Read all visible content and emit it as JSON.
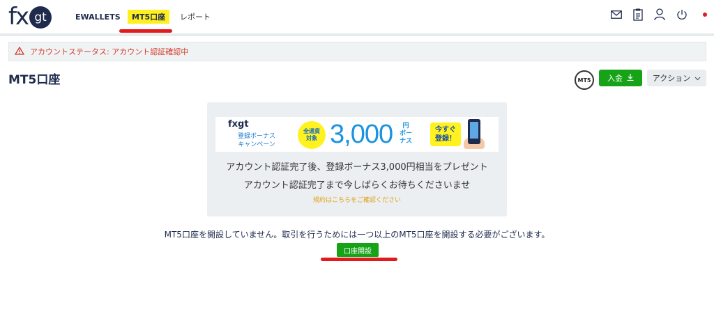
{
  "header": {
    "logo_fx": "fx",
    "logo_gt": "gt",
    "nav": {
      "ewallets": "EWALLETS",
      "mt5": "MT5口座",
      "report": "レポート"
    },
    "icons": [
      "mail-icon",
      "clipboard-icon",
      "user-icon",
      "power-icon",
      "language-flag-icon"
    ]
  },
  "alert": {
    "text": "アカウントステータス: アカウント認証確認中",
    "color": "#d23a2c"
  },
  "page": {
    "title": "MT5口座",
    "mt5_badge": "MT5",
    "deposit_button": "入金",
    "action_button": "アクション"
  },
  "card": {
    "banner": {
      "logo": "fxgt",
      "campaign_line1": "登録ボーナス",
      "campaign_line2": "キャンペーン",
      "badge_line1": "全通貨",
      "badge_line2": "対象",
      "amount": "3,000",
      "unit_line1": "円",
      "unit_line2": "ボー",
      "unit_line3": "ナス",
      "cta_line1": "今すぐ",
      "cta_line2": "登録！"
    },
    "line1": "アカウント認証完了後、登録ボーナス3,000円相当をプレゼント",
    "line2": "アカウント認証完了まで今しばらくお待ちくださいませ",
    "terms_link": "規約はこちらをご確認ください"
  },
  "empty_message": "MT5口座を開設していません。取引を行うためには一つ以上のMT5口座を開設する必要がございます。",
  "open_account_button": "口座開設",
  "colors": {
    "accent_green": "#17a317",
    "highlight_yellow": "#ffef1f",
    "annotation_red": "#e01b1b",
    "navy": "#1f2b4d"
  }
}
